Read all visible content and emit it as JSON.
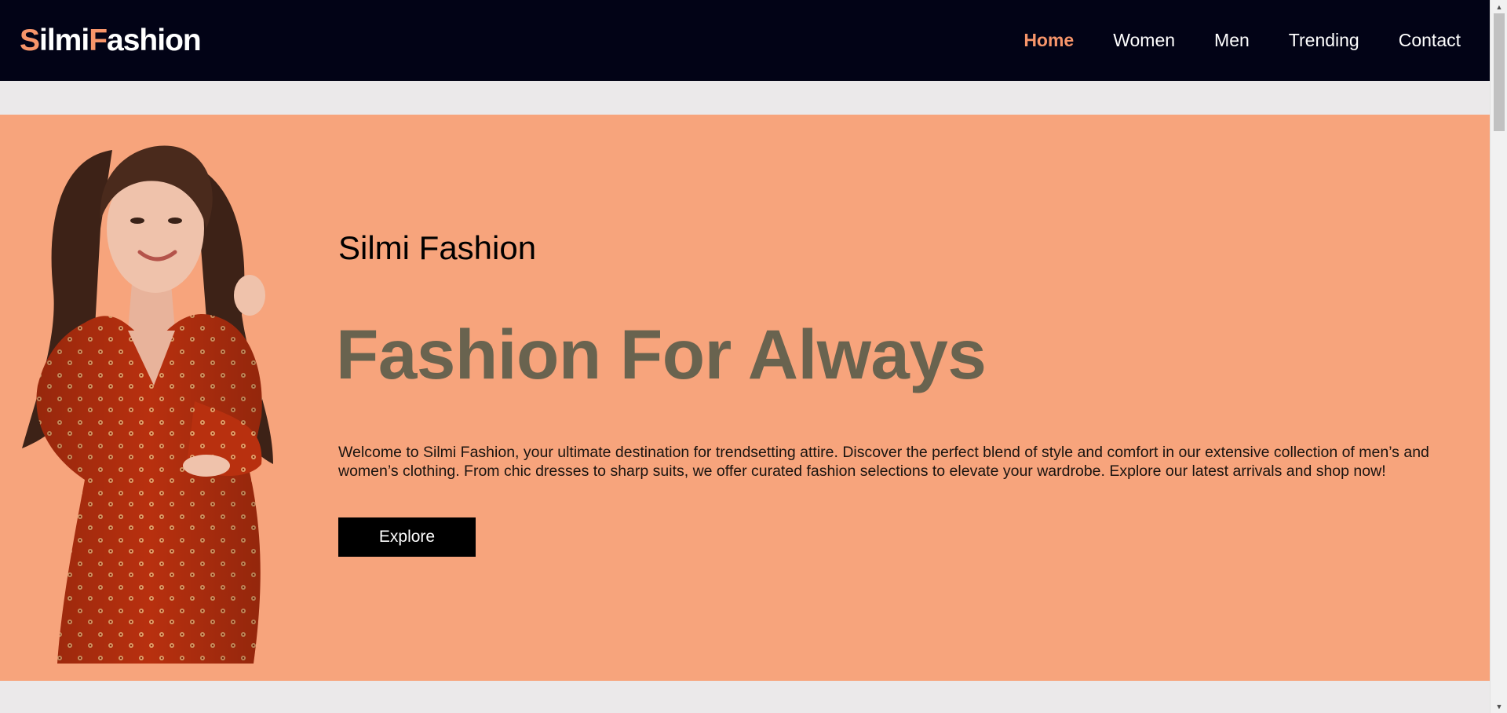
{
  "navbar": {
    "logo": {
      "first_initial": "S",
      "first_rest": "ilmi",
      "second_initial": "F",
      "second_rest": "ashion"
    },
    "links": [
      {
        "label": "Home",
        "active": true
      },
      {
        "label": "Women",
        "active": false
      },
      {
        "label": "Men",
        "active": false
      },
      {
        "label": "Trending",
        "active": false
      },
      {
        "label": "Contact",
        "active": false
      }
    ]
  },
  "hero": {
    "subtitle": "Silmi Fashion",
    "title": "Fashion For Always",
    "description": "Welcome to Silmi Fashion, your ultimate destination for trendsetting attire. Discover the perfect blend of style and comfort in our extensive collection of men’s and women’s clothing. From chic dresses to sharp suits, we offer curated fashion selections to elevate your wardrobe. Explore our latest arrivals and shop now!",
    "button_label": "Explore",
    "image_subject": "woman-in-red-dress"
  },
  "colors": {
    "navbar_bg": "#020316",
    "accent": "#f7956a",
    "hero_bg": "#f7a47c",
    "title_color": "#69634f",
    "page_bg": "#ebe9ea"
  },
  "scrollbar": {
    "up_icon": "triangle-up-icon",
    "down_icon": "triangle-down-icon"
  }
}
